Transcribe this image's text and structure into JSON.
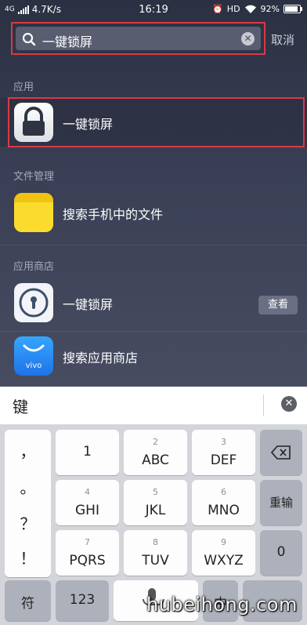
{
  "status_bar": {
    "network": "4G",
    "speed": "4.7K/s",
    "time": "16:19",
    "hd": "HD",
    "battery": "92%"
  },
  "search": {
    "query": "一键锁屏",
    "cancel_label": "取消"
  },
  "sections": {
    "apps_label": "应用",
    "files_label": "文件管理",
    "store_label": "应用商店"
  },
  "results": {
    "app_title": "一键锁屏",
    "files_title": "搜索手机中的文件",
    "store_app_title": "一键锁屏",
    "store_view_label": "查看",
    "store_search_title": "搜索应用商店",
    "vivo_label": "vivo"
  },
  "candidate": {
    "text": "键"
  },
  "keyboard": {
    "punctuation": [
      "，",
      "。",
      "？",
      "！"
    ],
    "keys": [
      {
        "sub": "",
        "main": "1"
      },
      {
        "sub": "2",
        "main": "ABC"
      },
      {
        "sub": "3",
        "main": "DEF"
      },
      {
        "sub": "4",
        "main": "GHI"
      },
      {
        "sub": "5",
        "main": "JKL"
      },
      {
        "sub": "6",
        "main": "MNO"
      },
      {
        "sub": "7",
        "main": "PQRS"
      },
      {
        "sub": "8",
        "main": "TUV"
      },
      {
        "sub": "9",
        "main": "WXYZ"
      }
    ],
    "reinput_label": "重输",
    "zero_label": "0",
    "symbol_label": "符",
    "num_label": "123",
    "lang_label": "中"
  },
  "watermark": "hubeihong.com",
  "colors": {
    "highlight": "#d73a46",
    "background_top": "#2b3042",
    "folder_yellow": "#f8d21c",
    "store_blue": "#2a8df5"
  }
}
